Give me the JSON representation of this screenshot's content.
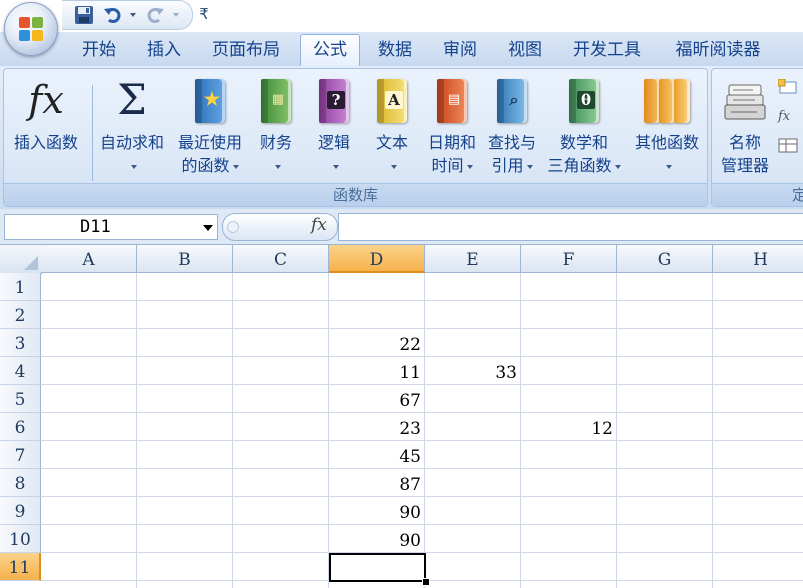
{
  "tabs": [
    {
      "label": "开始",
      "active": false
    },
    {
      "label": "插入",
      "active": false
    },
    {
      "label": "页面布局",
      "active": false
    },
    {
      "label": "公式",
      "active": true
    },
    {
      "label": "数据",
      "active": false
    },
    {
      "label": "审阅",
      "active": false
    },
    {
      "label": "视图",
      "active": false
    },
    {
      "label": "开发工具",
      "active": false
    },
    {
      "label": "福昕阅读器",
      "active": false
    }
  ],
  "quick_access": {
    "save_icon": "save-icon",
    "undo_icon": "undo-icon",
    "redo_icon": "redo-icon",
    "customize_glyph": "₹"
  },
  "ribbon": {
    "function_library": {
      "label": "函数库",
      "buttons": [
        {
          "id": "insert-function",
          "line1": "插入函数",
          "line2": "",
          "icon": "fx-icon"
        },
        {
          "id": "autosum",
          "line1": "自动求和",
          "line2": "",
          "icon": "sigma-icon",
          "dropdown": true
        },
        {
          "id": "recently-used",
          "line1": "最近使用",
          "line2": "的函数",
          "icon": "star-book-icon",
          "dropdown": true
        },
        {
          "id": "financial",
          "line1": "财务",
          "line2": "",
          "icon": "financial-book-icon",
          "dropdown": true
        },
        {
          "id": "logical",
          "line1": "逻辑",
          "line2": "",
          "icon": "logical-book-icon",
          "dropdown": true
        },
        {
          "id": "text",
          "line1": "文本",
          "line2": "",
          "icon": "text-book-icon",
          "dropdown": true
        },
        {
          "id": "date-time",
          "line1": "日期和",
          "line2": "时间",
          "icon": "calendar-book-icon",
          "dropdown": true
        },
        {
          "id": "lookup-reference",
          "line1": "查找与",
          "line2": "引用",
          "icon": "lookup-book-icon",
          "dropdown": true
        },
        {
          "id": "math-trig",
          "line1": "数学和",
          "line2": "三角函数",
          "icon": "theta-book-icon",
          "dropdown": true
        },
        {
          "id": "more-functions",
          "line1": "其他函数",
          "line2": "",
          "icon": "books-icon",
          "dropdown": true
        }
      ]
    },
    "defined_names": {
      "label": "定",
      "name_manager": {
        "line1": "名称",
        "line2": "管理器"
      }
    }
  },
  "formula_bar": {
    "name_box": "D11",
    "fx_label": "fx",
    "formula": ""
  },
  "grid": {
    "columns": [
      "A",
      "B",
      "C",
      "D",
      "E",
      "F",
      "G",
      "H"
    ],
    "rows": [
      "1",
      "2",
      "3",
      "4",
      "5",
      "6",
      "7",
      "8",
      "9",
      "10",
      "11"
    ],
    "selected_column": "D",
    "selected_row": "11",
    "cells": [
      {
        "ref": "D3",
        "value": "22"
      },
      {
        "ref": "D4",
        "value": "11"
      },
      {
        "ref": "E4",
        "value": "33"
      },
      {
        "ref": "D5",
        "value": "67"
      },
      {
        "ref": "D6",
        "value": "23"
      },
      {
        "ref": "F6",
        "value": "12"
      },
      {
        "ref": "D7",
        "value": "45"
      },
      {
        "ref": "D8",
        "value": "87"
      },
      {
        "ref": "D9",
        "value": "90"
      },
      {
        "ref": "D10",
        "value": "90"
      }
    ]
  }
}
